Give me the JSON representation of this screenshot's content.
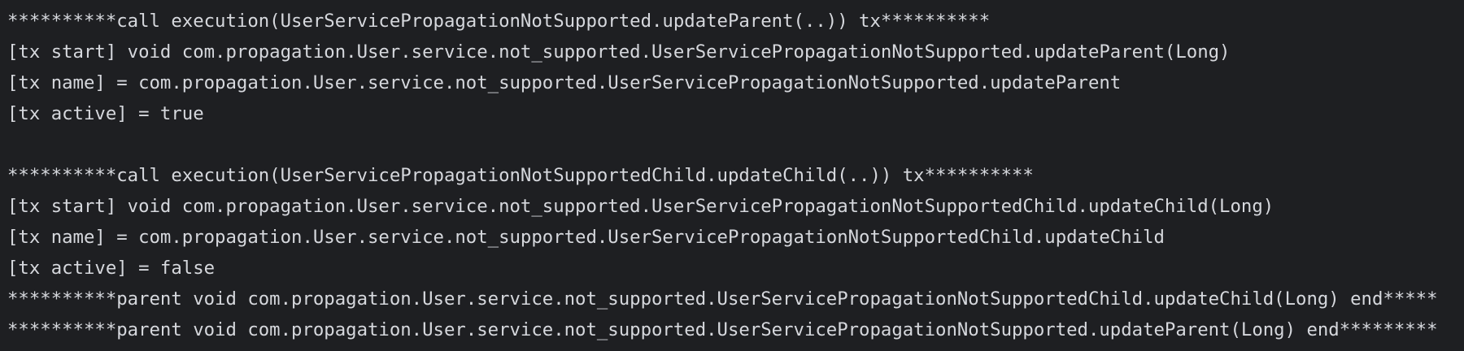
{
  "console": {
    "lines": [
      "**********call execution(UserServicePropagationNotSupported.updateParent(..)) tx**********",
      "[tx start] void com.propagation.User.service.not_supported.UserServicePropagationNotSupported.updateParent(Long)",
      "[tx name] = com.propagation.User.service.not_supported.UserServicePropagationNotSupported.updateParent",
      "[tx active] = true",
      "",
      "**********call execution(UserServicePropagationNotSupportedChild.updateChild(..)) tx**********",
      "[tx start] void com.propagation.User.service.not_supported.UserServicePropagationNotSupportedChild.updateChild(Long)",
      "[tx name] = com.propagation.User.service.not_supported.UserServicePropagationNotSupportedChild.updateChild",
      "[tx active] = false",
      "**********parent void com.propagation.User.service.not_supported.UserServicePropagationNotSupportedChild.updateChild(Long) end*****",
      "**********parent void com.propagation.User.service.not_supported.UserServicePropagationNotSupported.updateParent(Long) end*********"
    ]
  }
}
